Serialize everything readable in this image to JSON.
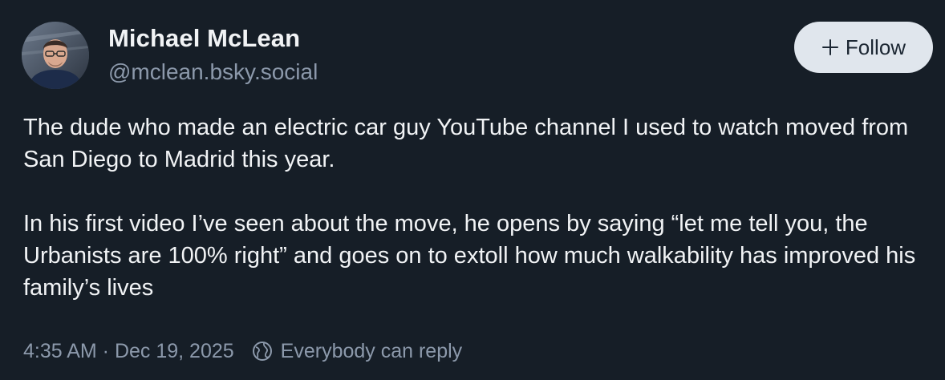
{
  "author": {
    "name": "Michael McLean",
    "handle": "@mclean.bsky.social",
    "avatar_icon": "avatar-photo"
  },
  "follow_button": {
    "label": "Follow",
    "icon": "plus-icon"
  },
  "post": {
    "paragraphs": [
      "The dude who made an electric car guy YouTube channel I used to watch moved from San Diego to Madrid this year.",
      "In his first video I’ve seen about the move, he opens by saying “let me tell you, the Urbanists are 100% right” and goes on to extoll how much walkability has improved his family’s lives"
    ]
  },
  "meta": {
    "timestamp": "4:35 AM · Dec 19, 2025",
    "reply_setting": "Everybody can reply",
    "reply_icon": "globe-icon"
  },
  "colors": {
    "background": "#161e27",
    "text_primary": "#f1f3f5",
    "text_secondary": "#8c99ab",
    "button_bg": "#e0e6ed",
    "button_text": "#1c2733"
  }
}
